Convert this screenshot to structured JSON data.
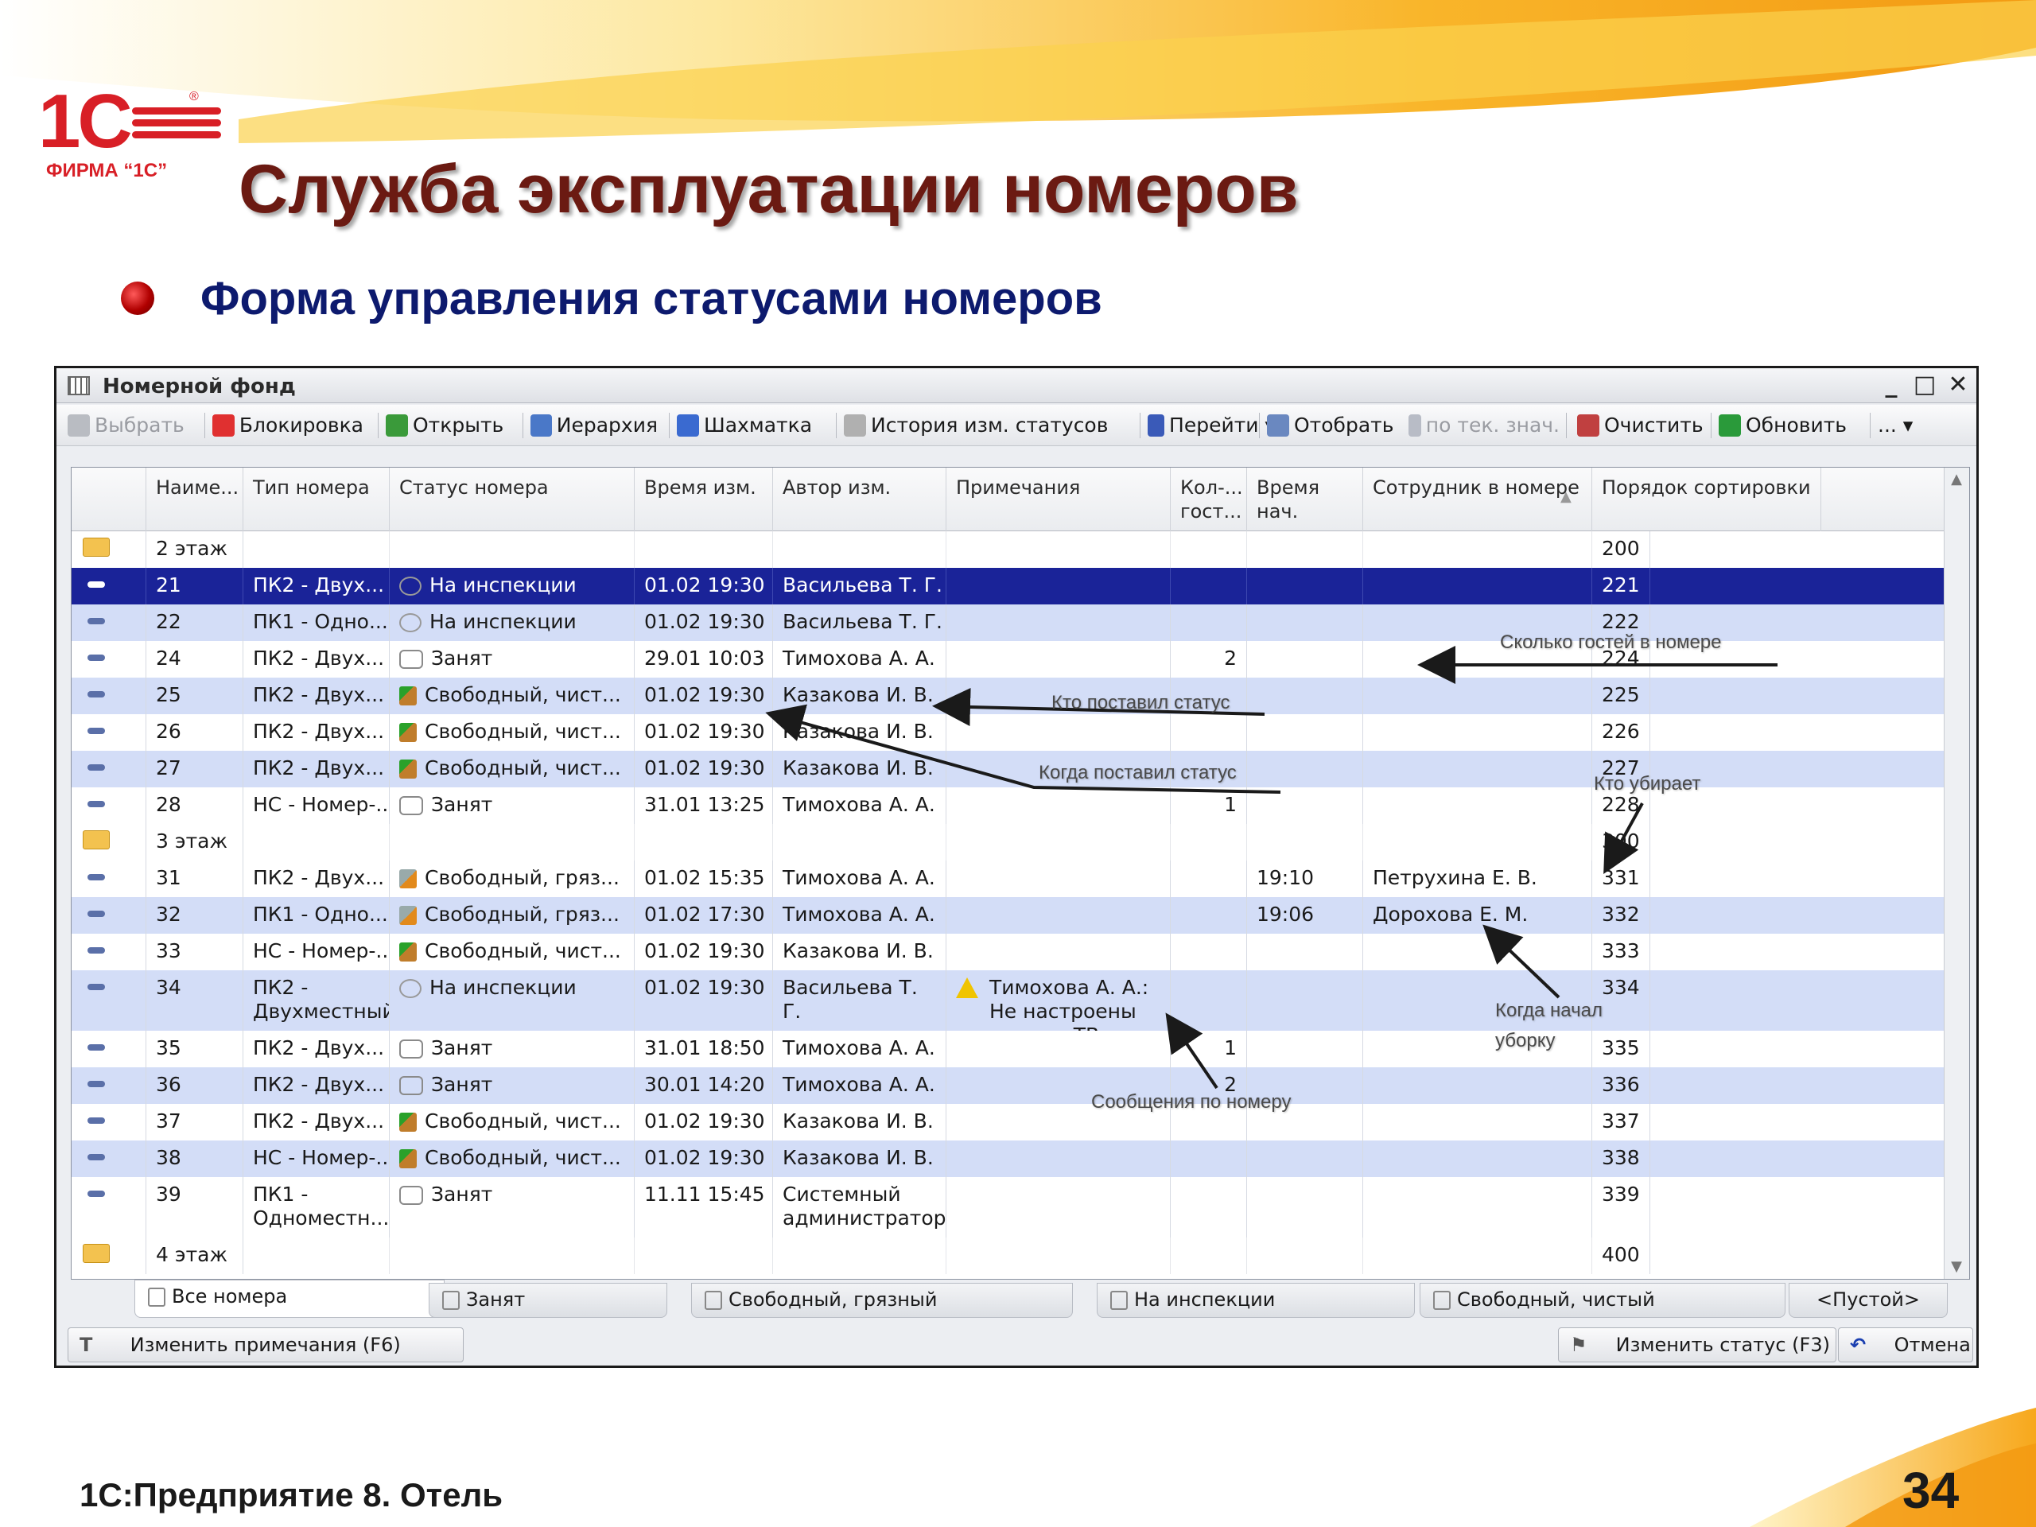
{
  "logo": {
    "text": "ФИРМА “1С”",
    "mark": "1С"
  },
  "slide": {
    "title": "Служба эксплуатации номеров",
    "subtitle": "Форма управления статусами номеров",
    "footer": "1С:Предприятие 8. Отель",
    "page": "34"
  },
  "window": {
    "title": "Номерной фонд",
    "controls": [
      "_",
      "□",
      "✕"
    ],
    "toolbar": [
      {
        "label": "Выбрать",
        "icon": "select-icon",
        "disabled": true
      },
      {
        "label": "Блокировка",
        "icon": "block-icon"
      },
      {
        "label": "Открыть",
        "icon": "pencil-icon"
      },
      {
        "label": "Иерархия",
        "icon": "hierarchy-icon"
      },
      {
        "label": "Шахматка",
        "icon": "person-icon"
      },
      {
        "label": "История изм. статусов",
        "icon": "history-icon"
      },
      {
        "label": "Перейти ▾",
        "icon": "goto-icon"
      },
      {
        "label": "Отобрать",
        "icon": "filter-icon"
      },
      {
        "label": "по тек. знач.",
        "icon": "filter-value-icon",
        "disabled": true
      },
      {
        "label": "Очистить",
        "icon": "clear-filter-icon"
      },
      {
        "label": "Обновить",
        "icon": "refresh-icon"
      },
      {
        "label": "... ▾",
        "icon": "more-icon"
      }
    ],
    "columns": [
      "Наиме...",
      "Тип номера",
      "Статус номера",
      "Время изм.",
      "Автор изм.",
      "Примечания",
      "Кол-... гост...",
      "Время нач.",
      "Сотрудник в номере",
      "Порядок сортировки"
    ],
    "rows": [
      {
        "kind": "group",
        "name": "2 этаж",
        "order": "200"
      },
      {
        "name": "21",
        "type": "ПК2 - Двух...",
        "status": "На инспекции",
        "status_icon": "inspection",
        "time": "01.02 19:30",
        "author": "Васильева Т. Г.",
        "note": "",
        "guests": "",
        "start": "",
        "staff": "",
        "order": "221",
        "selected": true
      },
      {
        "name": "22",
        "type": "ПК1 - Одно...",
        "status": "На инспекции",
        "status_icon": "inspection",
        "time": "01.02 19:30",
        "author": "Васильева Т. Г.",
        "note": "",
        "guests": "",
        "start": "",
        "staff": "",
        "order": "222"
      },
      {
        "name": "24",
        "type": "ПК2 - Двух...",
        "status": "Занят",
        "status_icon": "busy",
        "time": "29.01 10:03",
        "author": "Тимохова А. А.",
        "note": "",
        "guests": "2",
        "start": "",
        "staff": "",
        "order": "224"
      },
      {
        "name": "25",
        "type": "ПК2 - Двух...",
        "status": "Свободный, чист...",
        "status_icon": "clean",
        "time": "01.02 19:30",
        "author": "Казакова И. В.",
        "note": "",
        "guests": "",
        "start": "",
        "staff": "",
        "order": "225"
      },
      {
        "name": "26",
        "type": "ПК2 - Двух...",
        "status": "Свободный, чист...",
        "status_icon": "clean",
        "time": "01.02 19:30",
        "author": "Казакова И. В.",
        "note": "",
        "guests": "",
        "start": "",
        "staff": "",
        "order": "226"
      },
      {
        "name": "27",
        "type": "ПК2 - Двух...",
        "status": "Свободный, чист...",
        "status_icon": "clean",
        "time": "01.02 19:30",
        "author": "Казакова И. В.",
        "note": "",
        "guests": "",
        "start": "",
        "staff": "",
        "order": "227"
      },
      {
        "name": "28",
        "type": "НС - Номер-...",
        "status": "Занят",
        "status_icon": "busy",
        "time": "31.01 13:25",
        "author": "Тимохова А. А.",
        "note": "",
        "guests": "1",
        "start": "",
        "staff": "",
        "order": "228"
      },
      {
        "kind": "group",
        "name": "3 этаж",
        "order": "300"
      },
      {
        "name": "31",
        "type": "ПК2 - Двух...",
        "status": "Свободный, гряз...",
        "status_icon": "dirty",
        "time": "01.02 15:35",
        "author": "Тимохова А. А.",
        "note": "",
        "guests": "",
        "start": "19:10",
        "staff": "Петрухина Е. В.",
        "order": "331"
      },
      {
        "name": "32",
        "type": "ПК1 - Одно...",
        "status": "Свободный, гряз...",
        "status_icon": "dirty",
        "time": "01.02 17:30",
        "author": "Тимохова А. А.",
        "note": "",
        "guests": "",
        "start": "19:06",
        "staff": "Дорохова Е. М.",
        "order": "332"
      },
      {
        "name": "33",
        "type": "НС - Номер-...",
        "status": "Свободный, чист...",
        "status_icon": "clean",
        "time": "01.02 19:30",
        "author": "Казакова И. В.",
        "note": "",
        "guests": "",
        "start": "",
        "staff": "",
        "order": "333"
      },
      {
        "name": "34",
        "type": "ПК2 - Двухместный",
        "status": "На инспекции",
        "status_icon": "inspection",
        "time": "01.02 19:30",
        "author": "Васильева Т. Г.",
        "note": "Тимохова А. А.: Не настроены каналы ТВ",
        "guests": "",
        "start": "",
        "staff": "",
        "order": "334",
        "tall": true
      },
      {
        "name": "35",
        "type": "ПК2 - Двух...",
        "status": "Занят",
        "status_icon": "busy",
        "time": "31.01 18:50",
        "author": "Тимохова А. А.",
        "note": "",
        "guests": "1",
        "start": "",
        "staff": "",
        "order": "335"
      },
      {
        "name": "36",
        "type": "ПК2 - Двух...",
        "status": "Занят",
        "status_icon": "busy",
        "time": "30.01 14:20",
        "author": "Тимохова А. А.",
        "note": "",
        "guests": "2",
        "start": "",
        "staff": "",
        "order": "336"
      },
      {
        "name": "37",
        "type": "ПК2 - Двух...",
        "status": "Свободный, чист...",
        "status_icon": "clean",
        "time": "01.02 19:30",
        "author": "Казакова И. В.",
        "note": "",
        "guests": "",
        "start": "",
        "staff": "",
        "order": "337"
      },
      {
        "name": "38",
        "type": "НС - Номер-...",
        "status": "Свободный, чист...",
        "status_icon": "clean",
        "time": "01.02 19:30",
        "author": "Казакова И. В.",
        "note": "",
        "guests": "",
        "start": "",
        "staff": "",
        "order": "338"
      },
      {
        "name": "39",
        "type": "ПК1 - Одноместн...",
        "status": "Занят",
        "status_icon": "busy",
        "time": "11.11 15:45",
        "author": "Системный администратор",
        "note": "",
        "guests": "",
        "start": "",
        "staff": "",
        "order": "339",
        "tall": true
      },
      {
        "kind": "group",
        "name": "4 этаж",
        "order": "400"
      }
    ],
    "tabs": [
      {
        "label": "Все номера",
        "active": true,
        "icon": "all-rooms-icon"
      },
      {
        "label": "Занят",
        "icon": "busy-icon"
      },
      {
        "label": "Свободный, грязный",
        "icon": "dirty-icon"
      },
      {
        "label": "На инспекции",
        "icon": "inspection-icon"
      },
      {
        "label": "Свободный, чистый",
        "icon": "clean-icon"
      },
      {
        "label": "<Пустой>",
        "icon": ""
      }
    ],
    "bottom": {
      "edit_notes": "Изменить примечания (F6)",
      "change_status": "Изменить статус (F3)",
      "cancel": "Отмена"
    }
  },
  "annotations": [
    {
      "id": "guests",
      "text": "Сколько гостей в номере"
    },
    {
      "id": "who-set",
      "text": "Кто поставил статус"
    },
    {
      "id": "when-set",
      "text": "Когда поставил статус"
    },
    {
      "id": "who-cleans",
      "text": "Кто убирает"
    },
    {
      "id": "when-cleaning",
      "text": "Когда начал уборку"
    },
    {
      "id": "messages",
      "text": "Сообщения по номеру"
    }
  ],
  "colors": {
    "title": "#6b1a12",
    "subtitle": "#0d1a6e",
    "selection": "#1a2398",
    "stripe": "#d3ddf7",
    "brand_red": "#d81f26"
  }
}
